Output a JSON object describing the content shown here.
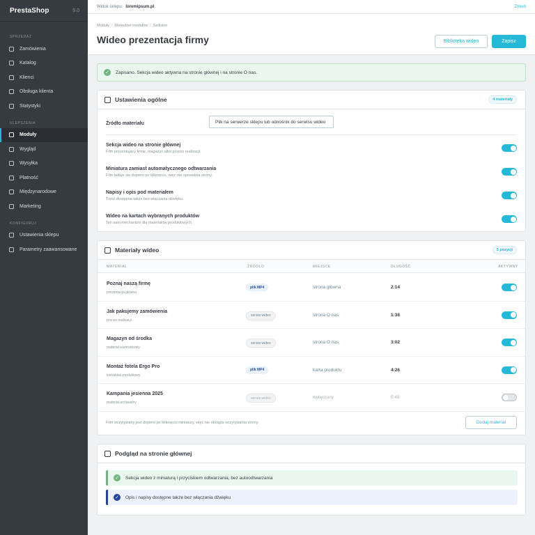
{
  "sidebar": {
    "brand": "PrestaShop",
    "version": "9.0",
    "sections": [
      {
        "title": "SPRZEDAŻ",
        "items": [
          "Zamówienia",
          "Katalog",
          "Klienci",
          "Obsługa klienta",
          "Statystyki"
        ]
      },
      {
        "title": "ULEPSZENIA",
        "items": [
          "Moduły",
          "Wygląd",
          "Wysyłka",
          "Płatność",
          "Międzynarodowe",
          "Marketing"
        ]
      },
      {
        "title": "KONFIGURUJ",
        "items": [
          "Ustawienia sklepu",
          "Parametry zaawansowane"
        ]
      }
    ],
    "active": "Moduły"
  },
  "topbar": {
    "label": "Widok sklepu:",
    "shop": "loremipsum.pl",
    "change": "Zmień"
  },
  "header": {
    "breadcrumbs": [
      "Moduły",
      "Menedżer modułów",
      "Sellision"
    ],
    "title": "Wideo prezentacja firmy",
    "library_button": "Biblioteka wideo",
    "save_button": "Zapisz"
  },
  "alert": {
    "text": "Zapisano. Sekcja wideo aktywna na stronie głównej i na stronie O nas."
  },
  "general": {
    "title": "Ustawienia ogólne",
    "badge": "4 materiały",
    "source_label": "Źródło materiału",
    "source_value": "Plik na serwerze sklepu lub odnośnik do serwisu wideo",
    "options": [
      {
        "title": "Sekcja wideo na stronie głównej",
        "desc": "Film prezentujący firmę, magazyn albo proces realizacji.",
        "on": true
      },
      {
        "title": "Miniatura zamiast automatycznego odtwarzania",
        "desc": "Film ładuje się dopiero po kliknięciu, więc nie spowalnia strony.",
        "on": true
      },
      {
        "title": "Napisy i opis pod materiałem",
        "desc": "Treść dostępna także bez włączania dźwięku.",
        "on": true
      },
      {
        "title": "Wideo na kartach wybranych produktów",
        "desc": "Ten sam mechanizm dla materiałów produktowych.",
        "on": true
      }
    ]
  },
  "materials": {
    "title": "Materiały wideo",
    "badge": "5 pozycji",
    "columns": [
      "MATERIAŁ",
      "ŹRÓDŁO",
      "MIEJSCE",
      "DŁUGOŚĆ",
      "AKTYWNY"
    ],
    "rows": [
      {
        "name": "Poznaj naszą firmę",
        "sub": "prezentacja główna",
        "source": "plik MP4",
        "source_type": "mp4",
        "place": "strona główna",
        "duration": "2:14",
        "active": true
      },
      {
        "name": "Jak pakujemy zamówienia",
        "sub": "proces realizacji",
        "source": "serwis wideo",
        "source_type": "svc",
        "place": "strona O nas",
        "duration": "1:38",
        "active": true
      },
      {
        "name": "Magazyn od środka",
        "sub": "materiał wizerunkowy",
        "source": "serwis wideo",
        "source_type": "svc",
        "place": "strona O nas",
        "duration": "3:02",
        "active": true
      },
      {
        "name": "Montaż fotela Ergo Pro",
        "sub": "instruktaż produktowy",
        "source": "plik MP4",
        "source_type": "mp4",
        "place": "karta produktu",
        "duration": "4:26",
        "active": true
      },
      {
        "name": "Kampania jesienna 2025",
        "sub": "materiał archiwalny",
        "source": "serwis wideo",
        "source_type": "svc",
        "place": "wyłączony",
        "duration": "0:48",
        "active": false
      }
    ],
    "footnote": "Film wczytywany jest dopiero po kliknięciu miniatury, więc nie obciąża wczytywania strony.",
    "add_button": "Dodaj materiał"
  },
  "preview": {
    "title": "Podgląd na stronie głównej",
    "notes": [
      {
        "text": "Sekcja wideo z miniaturą i przyciskiem odtwarzania, bez autoodtwarzania",
        "type": "green"
      },
      {
        "text": "Opis i napisy dostępne także bez włączania dźwięku",
        "type": "blue"
      }
    ]
  },
  "colors": {
    "accent": "#25b9d7",
    "sidebar": "#363a41",
    "success": "#70b580",
    "info": "#25439a"
  }
}
